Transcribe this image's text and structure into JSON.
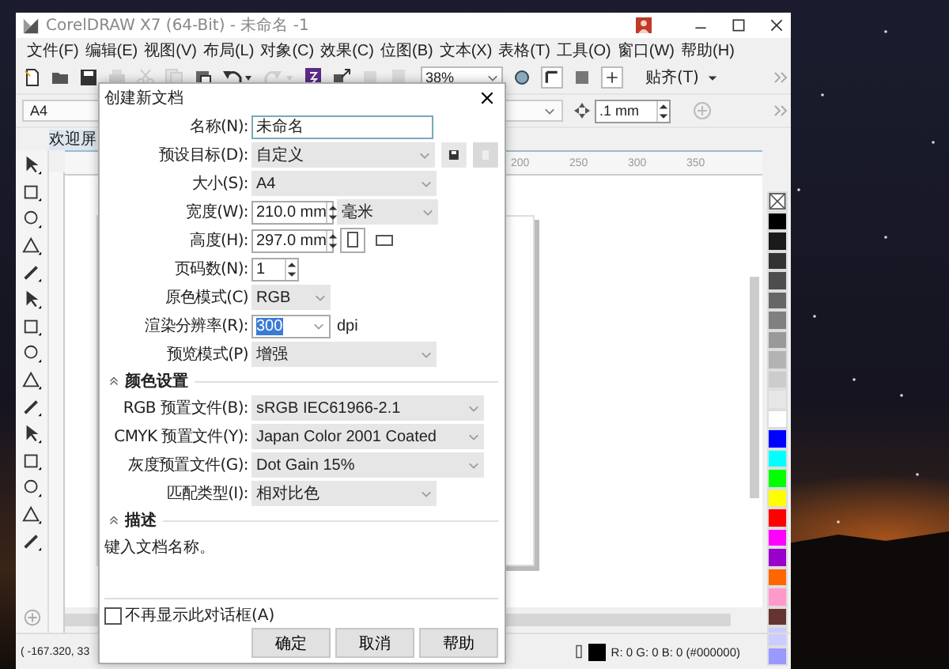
{
  "window": {
    "title": "CorelDRAW X7 (64-Bit) - 未命名 -1"
  },
  "menu": [
    "文件(F)",
    "编辑(E)",
    "视图(V)",
    "布局(L)",
    "对象(C)",
    "效果(C)",
    "位图(B)",
    "文本(X)",
    "表格(T)",
    "工具(O)",
    "窗口(W)",
    "帮助(H)"
  ],
  "toolbar": {
    "zoom": "38%",
    "snap": "贴齐(T)"
  },
  "property_bar": {
    "page_size": "A4",
    "nudge": ".1 mm"
  },
  "document_tab": "欢迎屏",
  "ruler_labels": [
    "200",
    "250",
    "300",
    "350"
  ],
  "palette": [
    {
      "color": "#000000"
    },
    {
      "color": "#1a1a1a"
    },
    {
      "color": "#333333"
    },
    {
      "color": "#4d4d4d"
    },
    {
      "color": "#666666"
    },
    {
      "color": "#808080"
    },
    {
      "color": "#999999"
    },
    {
      "color": "#b3b3b3"
    },
    {
      "color": "#cccccc"
    },
    {
      "color": "#e6e6e6"
    },
    {
      "color": "#ffffff"
    },
    {
      "color": "#0000ff"
    },
    {
      "color": "#00ffff"
    },
    {
      "color": "#00ff00"
    },
    {
      "color": "#ffff00"
    },
    {
      "color": "#ff0000"
    },
    {
      "color": "#ff00ff"
    },
    {
      "color": "#9900cc"
    },
    {
      "color": "#ff6600"
    },
    {
      "color": "#ff99cc"
    },
    {
      "color": "#663333"
    },
    {
      "color": "#ccccff"
    },
    {
      "color": "#9999ff"
    }
  ],
  "status_bar": {
    "coordinates": "( -167.320, 33",
    "fill": "R: 0 G: 0 B: 0 (#000000)"
  },
  "dialog": {
    "title": "创建新文档",
    "fields": [
      {
        "kind": "text",
        "label": "名称(N):",
        "value": "未命名"
      },
      {
        "kind": "preset",
        "label": "预设目标(D):",
        "value": "自定义"
      },
      {
        "kind": "select",
        "label": "大小(S):",
        "value": "A4"
      },
      {
        "kind": "spin_unit",
        "label": "宽度(W):",
        "value": "210.0 mm",
        "unit": "毫米"
      },
      {
        "kind": "spin_orient",
        "label": "高度(H):",
        "value": "297.0 mm",
        "orientations": [
          {
            "selected": true
          },
          {
            "selected": false
          }
        ]
      },
      {
        "kind": "spin",
        "label": "页码数(N):",
        "value": "1"
      },
      {
        "kind": "select_narrow",
        "label": "原色模式(C)",
        "value": "RGB"
      },
      {
        "kind": "select_dpi",
        "label": "渲染分辨率(R):",
        "value": "300",
        "highlighted": true,
        "unit": "dpi"
      },
      {
        "kind": "select",
        "label": "预览模式(P)",
        "value": "增强"
      }
    ],
    "color_section": {
      "title": "颜色设置",
      "expanded": true,
      "fields": [
        {
          "kind": "select_wide",
          "label": "RGB 预置文件(B):",
          "value": "sRGB IEC61966-2.1"
        },
        {
          "kind": "select_wide",
          "label": "CMYK 预置文件(Y):",
          "value": "Japan Color 2001 Coated"
        },
        {
          "kind": "select_wide",
          "label": "灰度预置文件(G):",
          "value": "Dot Gain 15%"
        },
        {
          "kind": "select",
          "label": "匹配类型(I):",
          "value": "相对比色"
        }
      ]
    },
    "description": {
      "title": "描述",
      "expanded": true,
      "text": "键入文档名称。"
    },
    "dont_show": {
      "label": "不再显示此对话框(A)",
      "checked": false
    },
    "buttons": [
      "确定",
      "取消",
      "帮助"
    ]
  }
}
